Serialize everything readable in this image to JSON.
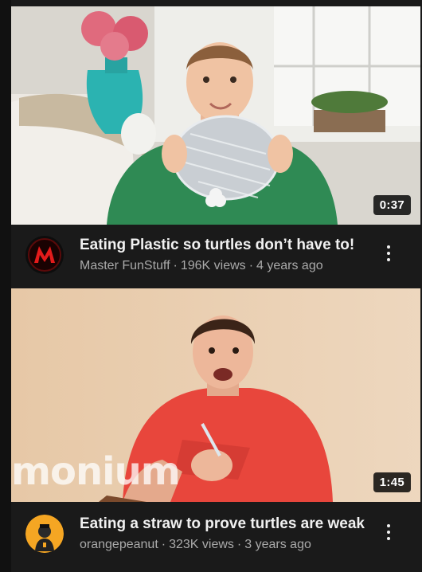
{
  "feed": {
    "videos": [
      {
        "title": "Eating Plastic so turtles don’t have to!",
        "channel": "Master FunStuff",
        "views": "196K views",
        "age": "4 years ago",
        "duration": "0:37",
        "avatar_icon": "master-funstuff-logo",
        "more_icon": "more-vert-icon"
      },
      {
        "title": "Eating a straw to prove turtles are weak",
        "channel": "orangepeanut",
        "views": "323K views",
        "age": "3 years ago",
        "duration": "1:45",
        "watermark": "monium",
        "avatar_icon": "orangepeanut-avatar",
        "more_icon": "more-vert-icon"
      }
    ]
  },
  "colors": {
    "background": "#1a1a1a",
    "title_text": "#f1f1f1",
    "secondary_text": "#aaaaaa",
    "duration_badge": "#000000"
  }
}
